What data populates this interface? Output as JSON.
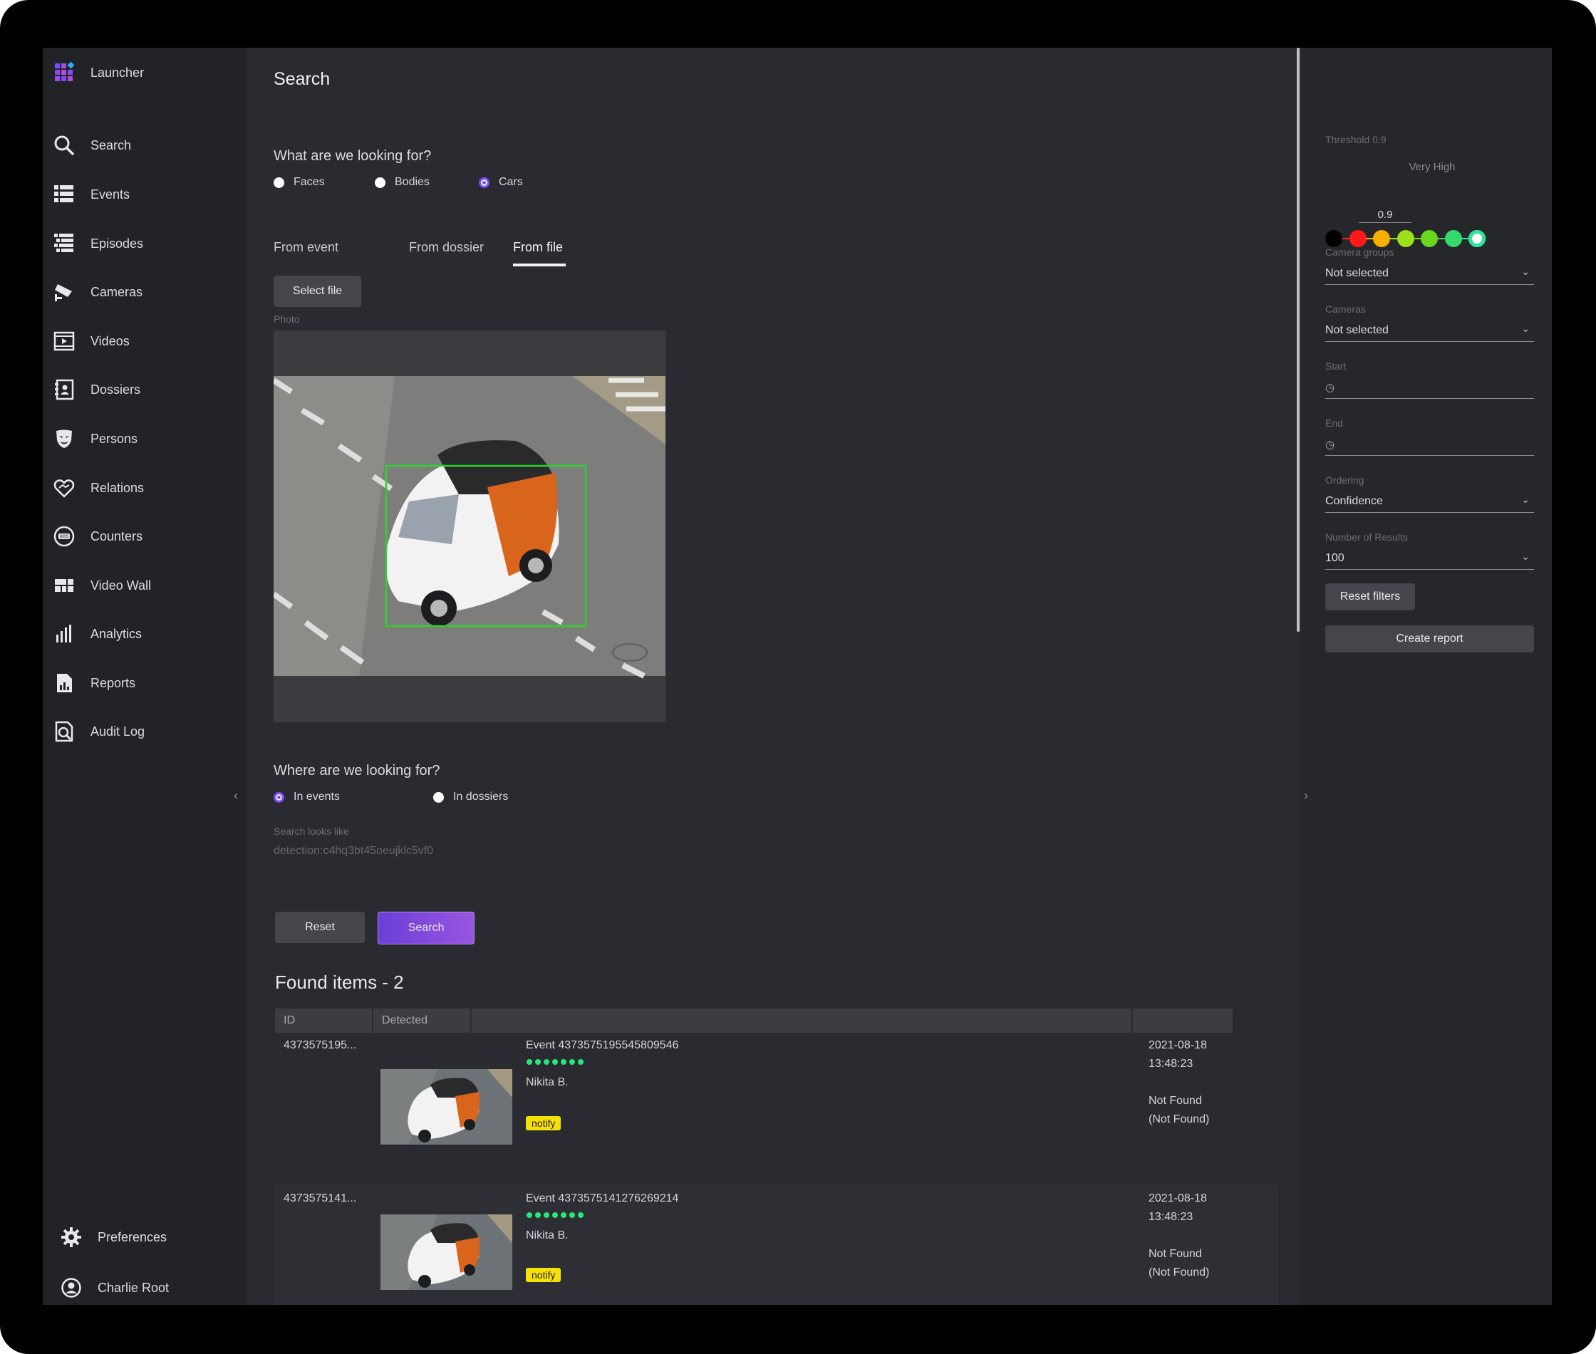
{
  "sidebar": {
    "launcher": "Launcher",
    "items": [
      {
        "label": "Search",
        "icon": "search-icon"
      },
      {
        "label": "Events",
        "icon": "events-icon"
      },
      {
        "label": "Episodes",
        "icon": "episodes-icon"
      },
      {
        "label": "Cameras",
        "icon": "camera-icon"
      },
      {
        "label": "Videos",
        "icon": "video-icon"
      },
      {
        "label": "Dossiers",
        "icon": "dossier-icon"
      },
      {
        "label": "Persons",
        "icon": "persons-icon"
      },
      {
        "label": "Relations",
        "icon": "relations-icon"
      },
      {
        "label": "Counters",
        "icon": "counter-icon"
      },
      {
        "label": "Video Wall",
        "icon": "video-wall-icon"
      },
      {
        "label": "Analytics",
        "icon": "analytics-icon"
      },
      {
        "label": "Reports",
        "icon": "reports-icon"
      },
      {
        "label": "Audit Log",
        "icon": "audit-log-icon"
      }
    ],
    "preferences": "Preferences",
    "user": "Charlie Root"
  },
  "main": {
    "title": "Search",
    "looking_for": {
      "question": "What are we looking for?",
      "options": [
        "Faces",
        "Bodies",
        "Cars"
      ],
      "selected": "Cars"
    },
    "tabs": [
      "From event",
      "From dossier",
      "From file"
    ],
    "active_tab": "From file",
    "select_file": "Select file",
    "photo_label": "Photo",
    "where": {
      "question": "Where are we looking for?",
      "options": [
        "In events",
        "In dossiers"
      ],
      "selected": "In events"
    },
    "search_looks_like_label": "Search looks like",
    "search_query": "detection:c4hq3bt45oeujklc5vf0",
    "reset": "Reset",
    "search": "Search",
    "found_title": "Found items - 2",
    "table": {
      "headers": [
        "ID",
        "Detected",
        "",
        ""
      ],
      "rows": [
        {
          "id": "4373575195...",
          "event": "Event 4373575195545809546",
          "name": "Nikita B.",
          "tag": "notify",
          "date": "2021-08-18",
          "time": "13:48:23",
          "status1": "Not Found",
          "status2": "(Not Found)"
        },
        {
          "id": "4373575141...",
          "event": "Event 4373575141276269214",
          "name": "Nikita B.",
          "tag": "notify",
          "date": "2021-08-18",
          "time": "13:48:23",
          "status1": "Not Found",
          "status2": "(Not Found)"
        }
      ]
    }
  },
  "filters": {
    "threshold_label": "Threshold 0.9",
    "threshold_level": "Very High",
    "threshold_value": "0.9",
    "threshold_colors": [
      "#000000",
      "#ff1a1a",
      "#f5b000",
      "#9be21a",
      "#6ad61e",
      "#33d96a",
      "#2fe39a"
    ],
    "camera_groups_label": "Camera groups",
    "camera_groups": "Not selected",
    "cameras_label": "Cameras",
    "cameras": "Not selected",
    "start_label": "Start",
    "end_label": "End",
    "ordering_label": "Ordering",
    "ordering": "Confidence",
    "results_label": "Number of Results",
    "results": "100",
    "reset_filters": "Reset filters",
    "create_report": "Create report"
  }
}
